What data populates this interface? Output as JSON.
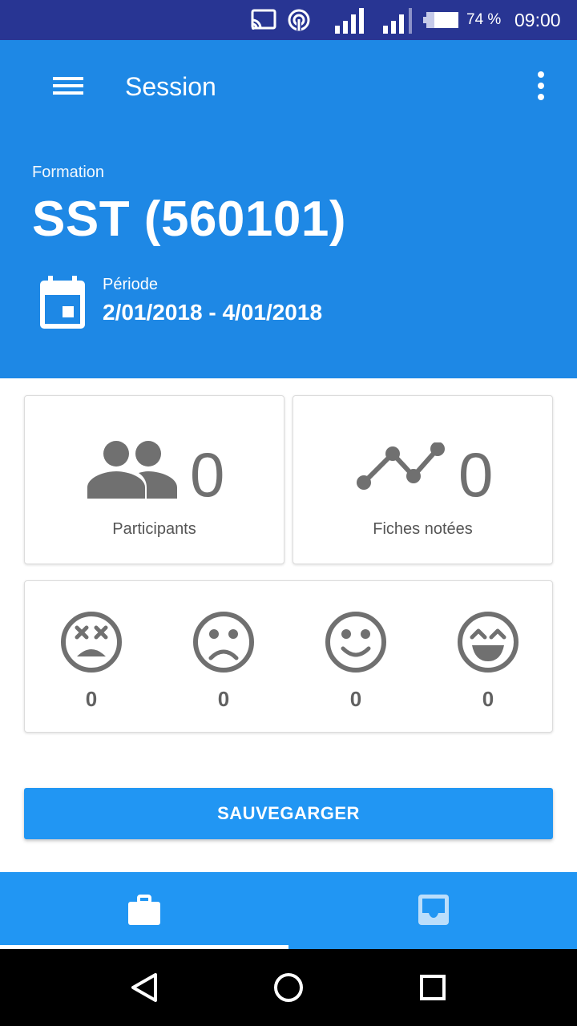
{
  "status_bar": {
    "battery_text": "74 %",
    "time": "09:00",
    "icons": [
      "cast-icon",
      "hotspot-icon",
      "signal-icon",
      "signal-icon",
      "battery-icon"
    ]
  },
  "app_bar": {
    "title": "Session",
    "menu_icon": "menu-icon",
    "overflow_icon": "more-vert-icon"
  },
  "formation": {
    "label": "Formation",
    "title": "SST (560101)"
  },
  "periode": {
    "label": "Période",
    "value": "2/01/2018 - 4/01/2018",
    "icon": "calendar-icon"
  },
  "stats": {
    "participants": {
      "value": "0",
      "label": "Participants",
      "icon": "people-icon"
    },
    "fiches": {
      "value": "0",
      "label": "Fiches notées",
      "icon": "trending-line-icon"
    }
  },
  "moods": [
    {
      "icon": "dead-face-icon",
      "count": "0"
    },
    {
      "icon": "sad-face-icon",
      "count": "0"
    },
    {
      "icon": "smile-face-icon",
      "count": "0"
    },
    {
      "icon": "grin-face-icon",
      "count": "0"
    }
  ],
  "save_button": {
    "label": "SAUVEGARGER"
  },
  "bottom_nav": {
    "tabs": [
      {
        "icon": "briefcase-icon",
        "selected": true
      },
      {
        "icon": "inbox-icon",
        "selected": false
      }
    ]
  },
  "colors": {
    "status_bar": "#283593",
    "app_bar": "#1e88e5",
    "accent": "#2196f3",
    "icon_grey": "#707070"
  }
}
